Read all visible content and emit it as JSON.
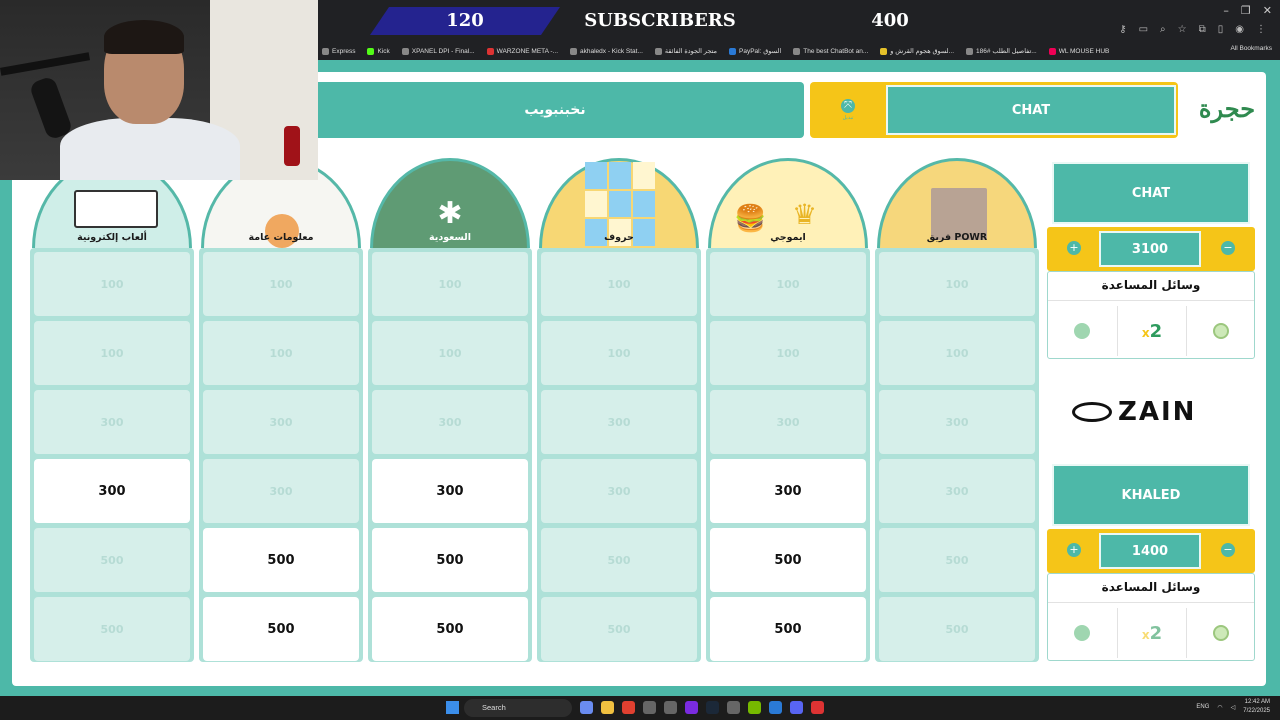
{
  "stream": {
    "sub_current": "120",
    "sub_label": "SUBSCRIBERS",
    "sub_goal": "400"
  },
  "browser": {
    "bookmarks": [
      "Express",
      "Kick",
      "XPANEL DPI - Final...",
      "WARZONE META -...",
      "akhaledx - Kick Stat...",
      "متجر الجودة الفائقة",
      "PayPal: السوق",
      "The best ChatBot an...",
      "لسوق هجوم القرش و...",
      "تفاصيل الطلب #186...",
      "WL MOUSE HUB"
    ],
    "all_bookmarks": "All Bookmarks"
  },
  "header": {
    "team_left_name": "نخبنبويب",
    "swap_label": "تبديل",
    "chat_label": "CHAT",
    "logo_text": "حجرة"
  },
  "categories": [
    {
      "label": "ألعاب إلكترونية"
    },
    {
      "label": "معلومات عامة"
    },
    {
      "label": "السعودية"
    },
    {
      "label": "حروف"
    },
    {
      "label": "ايموجي"
    },
    {
      "label": "فريق POWR"
    }
  ],
  "grid": {
    "rows": [
      [
        "100",
        "100",
        "100",
        "100",
        "100",
        "100"
      ],
      [
        "100",
        "100",
        "100",
        "100",
        "100",
        "100"
      ],
      [
        "300",
        "300",
        "300",
        "300",
        "300",
        "300"
      ],
      [
        "300",
        "300",
        "300",
        "300",
        "300",
        "300"
      ],
      [
        "500",
        "500",
        "500",
        "500",
        "500",
        "500"
      ],
      [
        "500",
        "500",
        "500",
        "500",
        "500",
        "500"
      ]
    ],
    "active": [
      [
        false,
        false,
        false,
        false,
        false,
        false
      ],
      [
        false,
        false,
        false,
        false,
        false,
        false
      ],
      [
        false,
        false,
        false,
        false,
        false,
        false
      ],
      [
        true,
        false,
        true,
        false,
        true,
        false
      ],
      [
        false,
        true,
        true,
        false,
        true,
        false
      ],
      [
        false,
        true,
        true,
        false,
        true,
        false
      ]
    ]
  },
  "team1": {
    "name": "CHAT",
    "score": "3100",
    "helpers_title": "وسائل المساعدة"
  },
  "team2": {
    "name": "KHALED",
    "score": "1400",
    "helpers_title": "وسائل المساعدة"
  },
  "sponsor": "ZAIN",
  "taskbar": {
    "search": "Search",
    "lang": "ENG",
    "time": "12:42 AM",
    "date": "7/22/2025"
  },
  "colors": {
    "teal": "#4db8a8",
    "yellow": "#f5c518",
    "cell_inactive": "#d6efea"
  }
}
